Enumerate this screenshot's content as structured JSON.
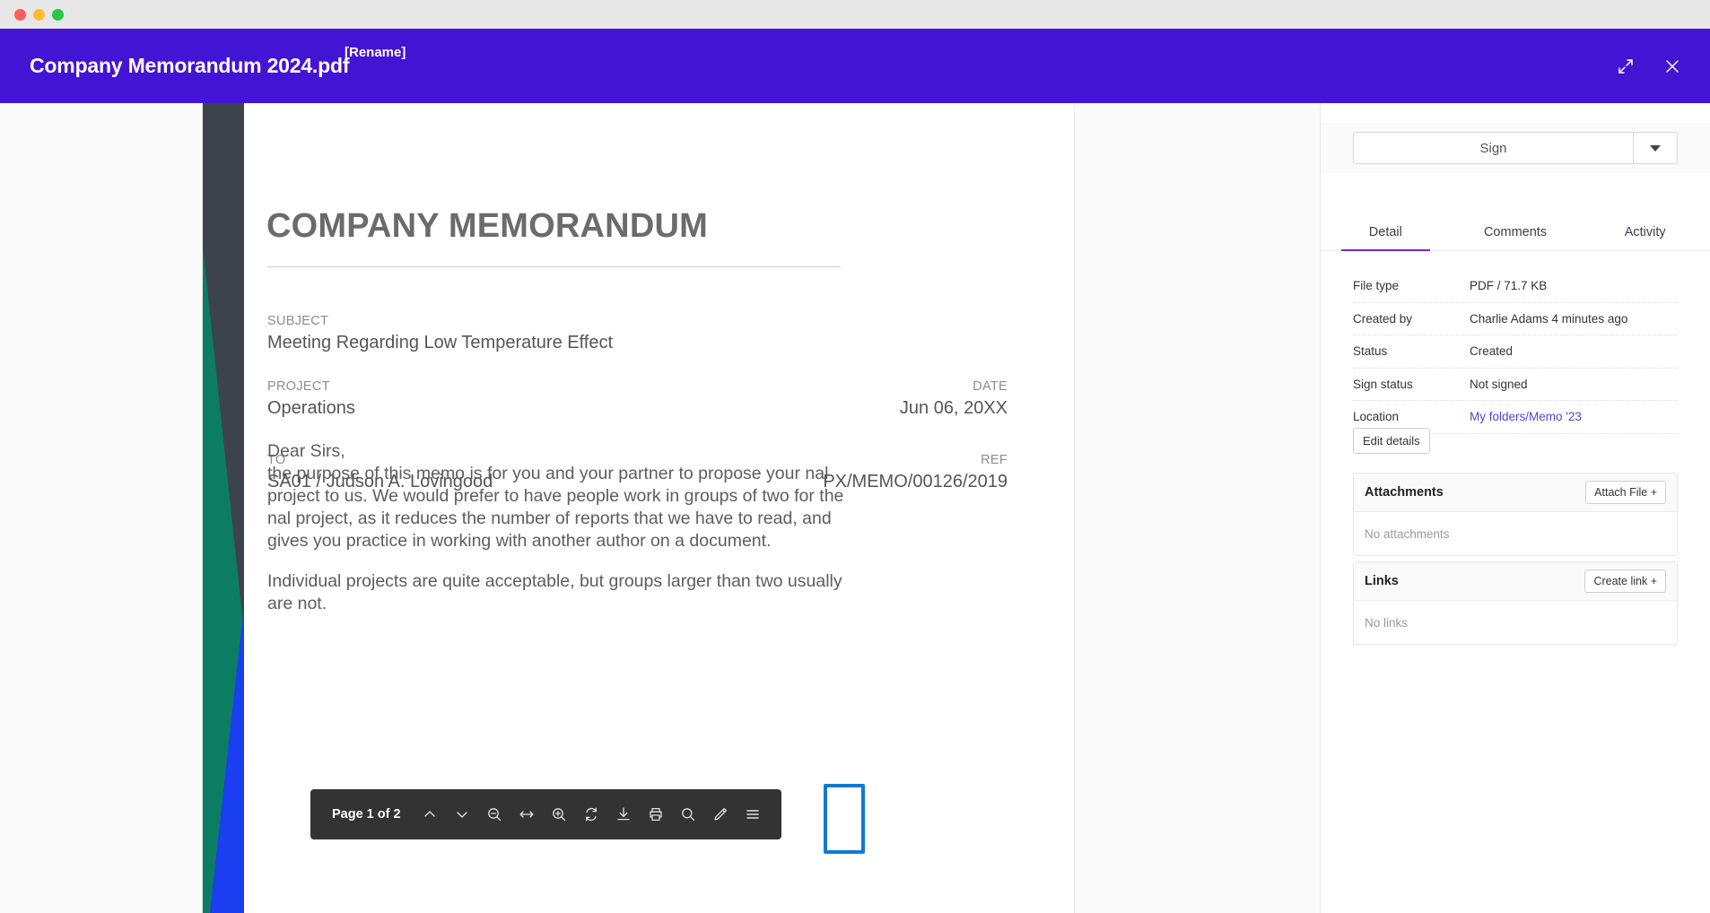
{
  "window": {
    "traffic_lights": [
      "close",
      "minimize",
      "maximize"
    ]
  },
  "header": {
    "title": "Company Memorandum 2024.pdf",
    "rename_tag": "[Rename]",
    "expand_icon": "expand-icon",
    "close_icon": "close-icon",
    "bg_color": "#4314d4"
  },
  "document": {
    "heading": "COMPANY MEMORANDUM",
    "fields": [
      {
        "label": "SUBJECT",
        "value": "Meeting Regarding Low Temperature Effect"
      },
      {
        "label": "PROJECT",
        "value": "Operations"
      },
      {
        "label": "DATE",
        "value": "Jun 06, 20XX"
      },
      {
        "label": "TO",
        "value": "SA01 / Judson A. Lovingood"
      },
      {
        "label": "REF",
        "value": "PX/MEMO/00126/2019"
      }
    ],
    "letter": {
      "salutation": "Dear Sirs,",
      "paragraph1": "the purpose of this memo is for you and your partner to propose your nal project to us. We would prefer to have people work in groups of two for the nal project, as it reduces the number of reports that we have to read, and gives you practice in working with another author on a document.",
      "paragraph2": "Individual projects are quite acceptable, but groups larger than two usually are not."
    },
    "stripe_colors": [
      "#3d434b",
      "#0c7c62",
      "#1a3ef0"
    ]
  },
  "pdf_toolbar": {
    "page_label": "Page 1 of 2",
    "buttons": [
      {
        "name": "previous-page-icon",
        "title": "Previous page"
      },
      {
        "name": "next-page-icon",
        "title": "Next page"
      },
      {
        "name": "zoom-out-icon",
        "title": "Zoom out"
      },
      {
        "name": "fit-width-icon",
        "title": "Fit width"
      },
      {
        "name": "zoom-in-icon",
        "title": "Zoom in"
      },
      {
        "name": "rotate-icon",
        "title": "Rotate"
      },
      {
        "name": "download-icon",
        "title": "Download"
      },
      {
        "name": "print-icon",
        "title": "Print"
      },
      {
        "name": "search-icon",
        "title": "Search"
      },
      {
        "name": "pencil-icon",
        "title": "Annotate"
      },
      {
        "name": "menu-icon",
        "title": "More"
      }
    ],
    "focused_button": "pencil-icon",
    "focus_color": "#1278d4",
    "bg_color": "#333333"
  },
  "sidebar": {
    "sign": {
      "label": "Sign",
      "dropdown_icon": "chevron-down-icon"
    },
    "tabs": [
      {
        "label": "Detail",
        "active": true
      },
      {
        "label": "Comments",
        "active": false
      },
      {
        "label": "Activity",
        "active": false
      }
    ],
    "active_tab_color": "#7722dd",
    "details": [
      {
        "key": "File type",
        "value": "PDF  /  71.7 KB",
        "link": false
      },
      {
        "key": "Created by",
        "value": "Charlie Adams 4 minutes ago",
        "link": false
      },
      {
        "key": "Status",
        "value": "Created",
        "link": false
      },
      {
        "key": "Sign status",
        "value": "Not signed",
        "link": false
      },
      {
        "key": "Location",
        "value": "My folders/Memo '23",
        "link": true
      }
    ],
    "edit_details_label": "Edit details",
    "attachments": {
      "title": "Attachments",
      "action_label": "Attach File  +",
      "empty_text": "No attachments"
    },
    "links": {
      "title": "Links",
      "action_label": "Create link  +",
      "empty_text": "No links"
    }
  }
}
